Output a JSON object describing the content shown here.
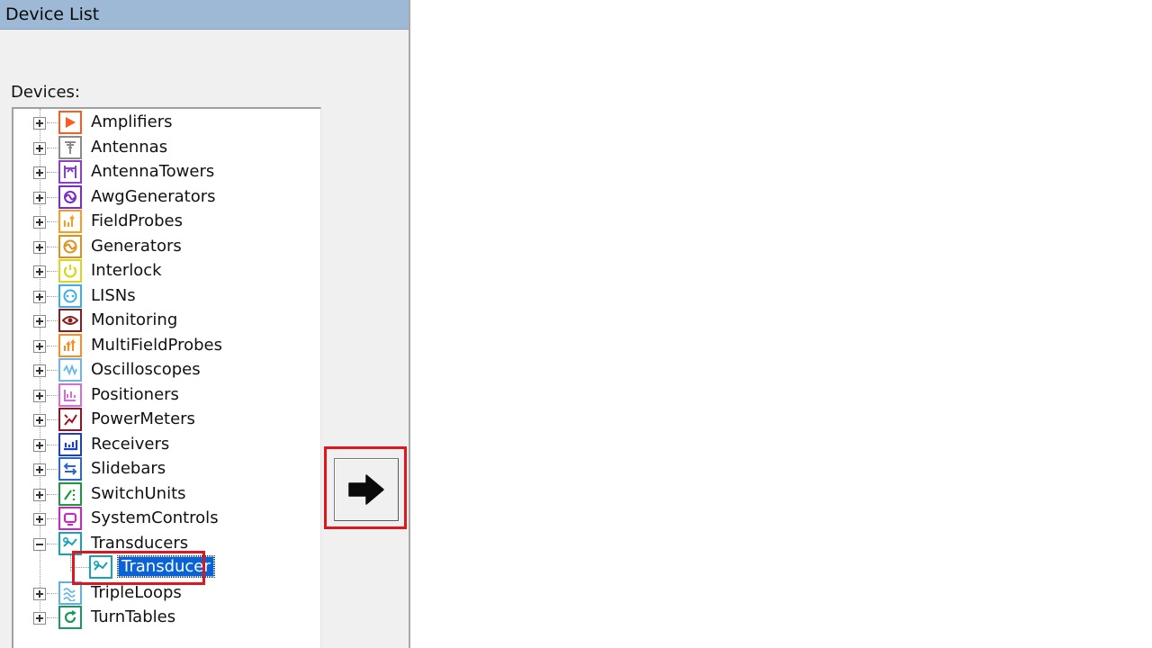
{
  "window": {
    "title": "Device List"
  },
  "tree": {
    "label": "Devices:",
    "items": [
      {
        "label": "Amplifiers",
        "icon": "amplifier-icon",
        "color": "#ff5a1f",
        "expanded": false
      },
      {
        "label": "Antennas",
        "icon": "antenna-icon",
        "color": "#8a8a8a",
        "expanded": false
      },
      {
        "label": "AntennaTowers",
        "icon": "antenna-tower-icon",
        "color": "#8b3dd6",
        "expanded": false
      },
      {
        "label": "AwgGenerators",
        "icon": "awg-generator-icon",
        "color": "#7a2bd0",
        "expanded": false
      },
      {
        "label": "FieldProbes",
        "icon": "field-probe-icon",
        "color": "#ff9a1f",
        "expanded": false
      },
      {
        "label": "Generators",
        "icon": "generator-icon",
        "color": "#e0901a",
        "expanded": false
      },
      {
        "label": "Interlock",
        "icon": "interlock-icon",
        "color": "#d7d71b",
        "expanded": false
      },
      {
        "label": "LISNs",
        "icon": "lisn-icon",
        "color": "#3aaee8",
        "expanded": false
      },
      {
        "label": "Monitoring",
        "icon": "monitoring-icon",
        "color": "#8b1c1c",
        "expanded": false
      },
      {
        "label": "MultiFieldProbes",
        "icon": "multi-field-probe-icon",
        "color": "#ff8a1f",
        "expanded": false
      },
      {
        "label": "Oscilloscopes",
        "icon": "oscilloscope-icon",
        "color": "#69b7e8",
        "expanded": false
      },
      {
        "label": "Positioners",
        "icon": "positioner-icon",
        "color": "#d36ed8",
        "expanded": false
      },
      {
        "label": "PowerMeters",
        "icon": "power-meter-icon",
        "color": "#a0101a",
        "expanded": false
      },
      {
        "label": "Receivers",
        "icon": "receiver-icon",
        "color": "#1a3fc8",
        "expanded": false
      },
      {
        "label": "Slidebars",
        "icon": "slidebar-icon",
        "color": "#2a64d8",
        "expanded": false
      },
      {
        "label": "SwitchUnits",
        "icon": "switch-unit-icon",
        "color": "#1a9a3a",
        "expanded": false
      },
      {
        "label": "SystemControls",
        "icon": "system-control-icon",
        "color": "#d21fd6",
        "expanded": false
      },
      {
        "label": "Transducers",
        "icon": "transducer-icon",
        "color": "#14a3b8",
        "expanded": true
      },
      {
        "label": "TripleLoops",
        "icon": "triple-loop-icon",
        "color": "#5ab2e6",
        "expanded": false
      },
      {
        "label": "TurnTables",
        "icon": "turntable-icon",
        "color": "#1a9a5a",
        "expanded": false
      }
    ],
    "child": {
      "label": "Transducer",
      "icon": "transducer-icon",
      "color": "#14a3b8",
      "selected": true
    }
  },
  "add_button": {
    "icon": "right-arrow-icon"
  },
  "colors": {
    "highlight": "#e0161e",
    "selection": "#0a63d6",
    "title_bar": "#9db9d6"
  }
}
